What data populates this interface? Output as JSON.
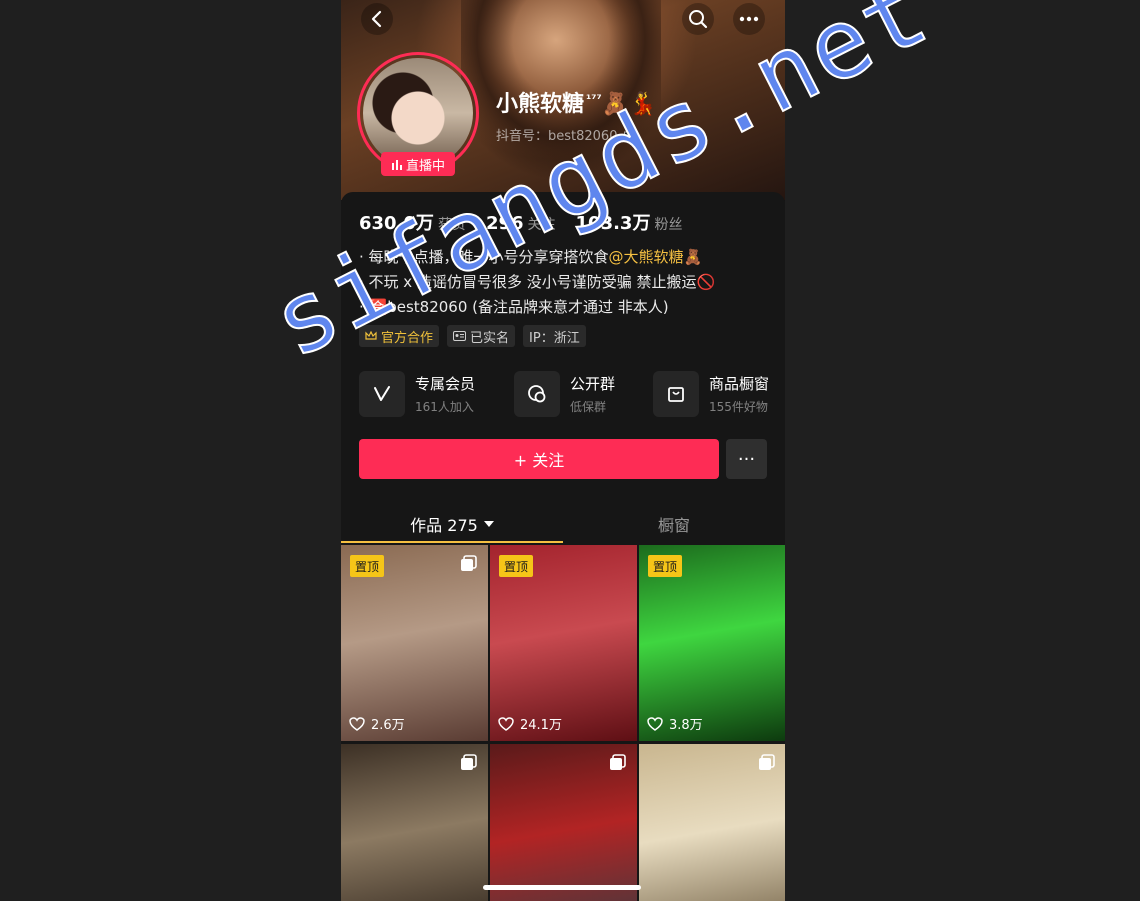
{
  "profile": {
    "name": "小熊软糖",
    "name_sup": "¹⁷⁷",
    "name_emoji": "🧸💃",
    "douyin_id": "抖音号：best82060",
    "live_badge": "直播中"
  },
  "stats": [
    {
      "num": "630.0万",
      "label": "获赞"
    },
    {
      "num": "296",
      "label": "关注"
    },
    {
      "num": "103.3万",
      "label": "粉丝"
    }
  ],
  "bio": {
    "line1_prefix": "· 每晚十点播，唯一小号分享穿搭饮食",
    "line1_mention": "@大熊软糖",
    "line1_emoji": "🧸",
    "line2": "· 不玩 x 造谣仿冒号很多 没小号谨防受骗 禁止搬运🚫",
    "line3": "· 🈴best82060 (备注品牌来意才通过 非本人)"
  },
  "tags": [
    "官方合作",
    "已实名",
    "IP：浙江"
  ],
  "features": [
    {
      "title": "专属会员",
      "sub": "161人加入",
      "icon": "v-icon"
    },
    {
      "title": "公开群",
      "sub": "低保群",
      "icon": "chat-icon"
    },
    {
      "title": "商品橱窗",
      "sub": "155件好物",
      "icon": "bag-icon"
    }
  ],
  "actions": {
    "follow_label": "+ 关注",
    "more_label": "···"
  },
  "tabs": {
    "works_label": "作品 275",
    "shop_label": "橱窗"
  },
  "posts": [
    {
      "pin": "置顶",
      "likes": "2.6万",
      "colors": [
        "#8a6a52",
        "#b59a86",
        "#5a3c33"
      ]
    },
    {
      "pin": "置顶",
      "likes": "24.1万",
      "colors": [
        "#a3232d",
        "#c94a50",
        "#5e0f14"
      ]
    },
    {
      "pin": "置顶",
      "likes": "3.8万",
      "colors": [
        "#1c6b1d",
        "#3fd640",
        "#0d3a0e"
      ]
    },
    {
      "pin": "",
      "likes": "",
      "colors": [
        "#3c3025",
        "#8c7a62",
        "#2a2018"
      ]
    },
    {
      "pin": "",
      "likes": "",
      "colors": [
        "#5a1a1a",
        "#b22424",
        "#3a3a40"
      ]
    },
    {
      "pin": "",
      "likes": "",
      "colors": [
        "#c9b68f",
        "#e8dcc0",
        "#6b5a3f"
      ]
    }
  ],
  "watermark": "sifangds.net",
  "colors": {
    "accent": "#fe2c55",
    "gold": "#f5c042",
    "background": "#161616"
  }
}
